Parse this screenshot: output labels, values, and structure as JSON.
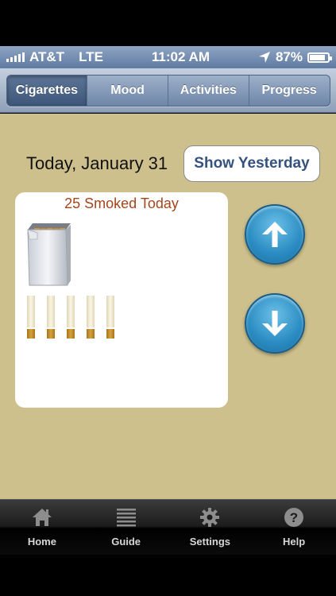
{
  "status_bar": {
    "carrier": "AT&T",
    "network": "LTE",
    "time": "11:02 AM",
    "battery": "87%",
    "battery_level": 0.87
  },
  "segments": [
    {
      "label": "Cigarettes",
      "active": true
    },
    {
      "label": "Mood",
      "active": false
    },
    {
      "label": "Activities",
      "active": false
    },
    {
      "label": "Progress",
      "active": false
    }
  ],
  "main": {
    "date_label": "Today, January 31",
    "show_yesterday_label": "Show Yesterday",
    "smoked_label": "25 Smoked Today",
    "full_packs": 1,
    "loose_cigarettes": 5
  },
  "icons": {
    "increment": "arrow-up-icon",
    "decrement": "arrow-down-icon"
  },
  "tabs": [
    {
      "label": "Home",
      "icon": "home-icon"
    },
    {
      "label": "Guide",
      "icon": "list-icon"
    },
    {
      "label": "Settings",
      "icon": "gear-icon"
    },
    {
      "label": "Help",
      "icon": "help-icon"
    }
  ],
  "colors": {
    "background": "#cdc08c",
    "accent": "#35527f",
    "count_text": "#a5451b",
    "button_blue": "#2a8bc2"
  }
}
